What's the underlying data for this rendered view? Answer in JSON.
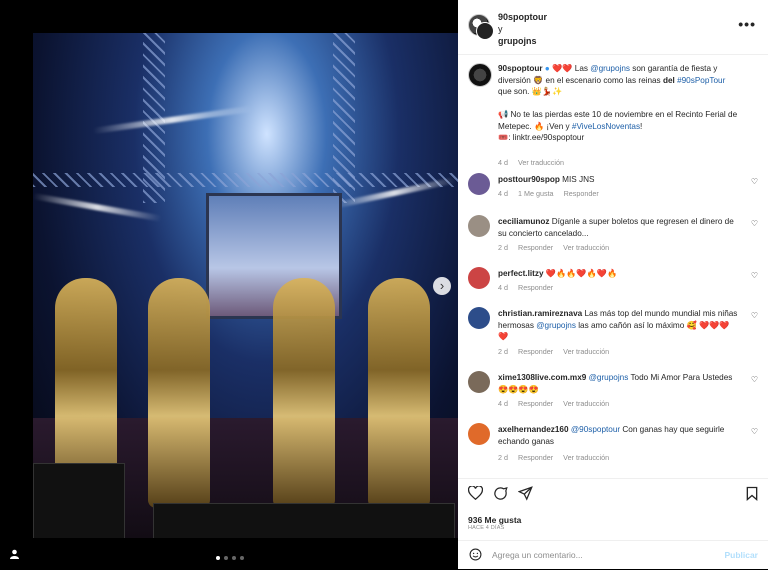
{
  "post": {
    "author": "90spoptour",
    "coauthor_sep": "y",
    "coauthor": "grupojns",
    "more_icon": "more-horizontal-icon",
    "caption": {
      "user": "90spoptour",
      "text_a": "❤️❤️ Las",
      "mention1": "@grupojns",
      "text_b": "son garantía de fiesta y diversión 🦁 en el escenario como las reinas",
      "text_c": "del",
      "hashtag1": "#90sPopTour",
      "text_d": "que son. 👑💃🏼✨",
      "line2": "📢 No te las pierdas este 10 de noviembre en el Recinto Ferial de Metepec. 🔥 ¡Ven y",
      "hashtag2": "#ViveLosNoventas",
      "line2_end": "!",
      "link": "🎟️: linktr.ee/90spoptour",
      "time": "4 d",
      "translate": "Ver traducción"
    },
    "comments": [
      {
        "user": "posttour90spop",
        "text": "MIS JNS",
        "time": "4 d",
        "likes": "1 Me gusta",
        "reply": "Responder",
        "translate": "",
        "color": "#6b5b95"
      },
      {
        "user": "ceciliamunoz",
        "text": "Díganle a super boletos que regresen el dinero de su concierto cancelado...",
        "time": "2 d",
        "likes": "",
        "reply": "Responder",
        "translate": "Ver traducción",
        "color": "#9a8f84"
      },
      {
        "user": "perfect.litzy",
        "text": "❤️🔥🔥❤️🔥❤️🔥",
        "time": "4 d",
        "likes": "",
        "reply": "Responder",
        "translate": "",
        "color": "#c44"
      },
      {
        "user": "christian.ramireznava",
        "text_a": "Las más top del mundo mundial mis niñas hermosas",
        "mention": "@grupojns",
        "text_b": "las amo cañón así lo máximo 🥰 ❤️❤️❤️❤️",
        "time": "2 d",
        "likes": "",
        "reply": "Responder",
        "translate": "Ver traducción",
        "color": "#2d4d8a"
      },
      {
        "user": "xime1308live.com.mx9",
        "mention": "@grupojns",
        "text_b": "Todo Mi Amor Para Ustedes 😍😍😍😍",
        "time": "4 d",
        "likes": "",
        "reply": "Responder",
        "translate": "Ver traducción",
        "color": "#7a6a5a"
      },
      {
        "user": "axelhernandez160",
        "mention": "@90spoptour",
        "text_b": "Con ganas hay que seguirle echando ganas",
        "time": "2 d",
        "likes": "",
        "reply": "Responder",
        "translate": "Ver traducción",
        "color": "#e06a2a"
      }
    ],
    "likes_count": "936 Me gusta",
    "posted": "HACE 4 DÍAS",
    "add_comment_placeholder": "Agrega un comentario...",
    "post_button": "Publicar"
  },
  "media": {
    "next_icon": "chevron-right-icon",
    "page_dots": 4,
    "active_dot": 0,
    "user_tag_icon": "person-icon"
  }
}
